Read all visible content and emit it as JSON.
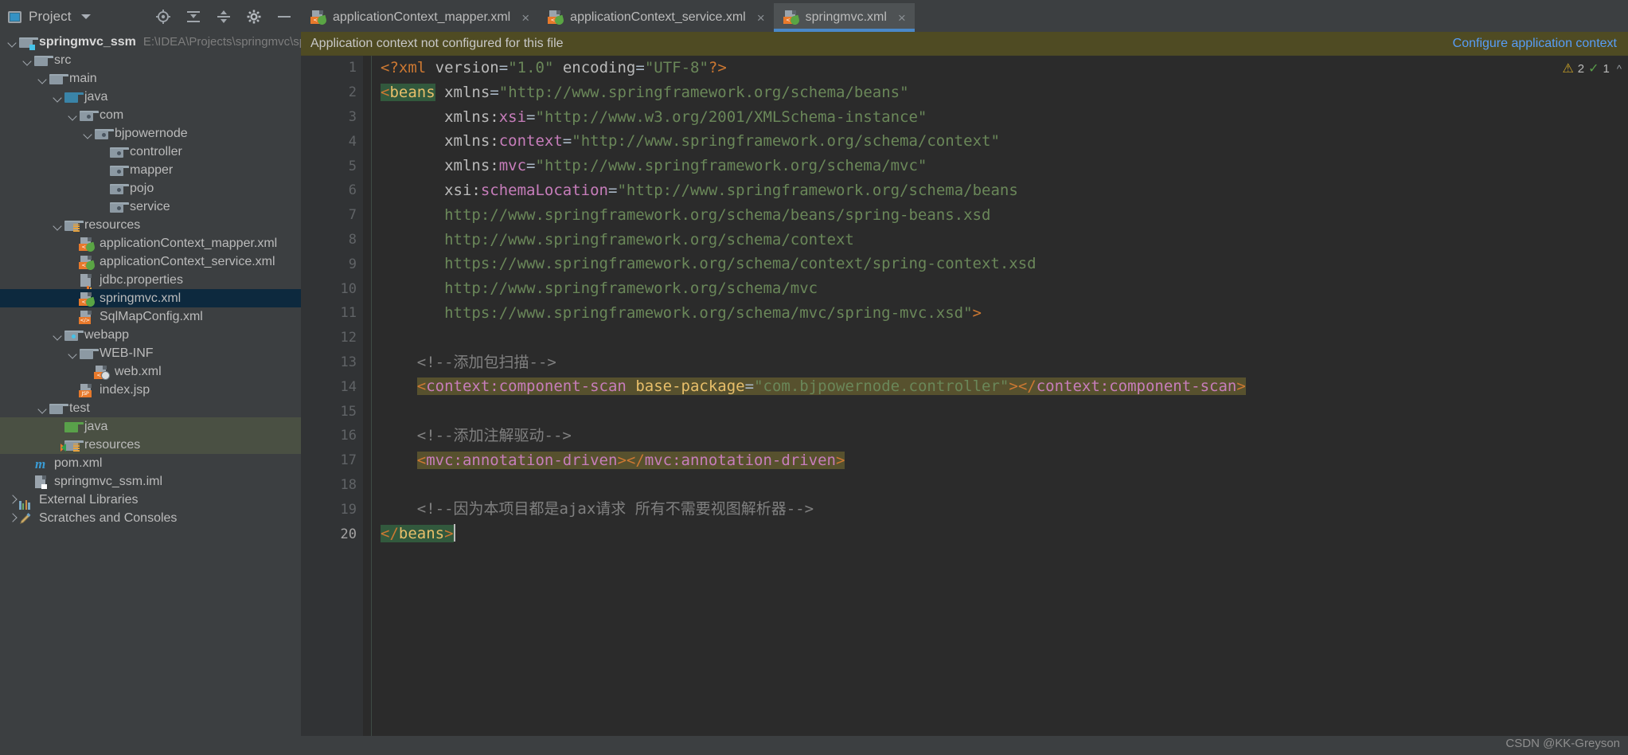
{
  "sidebar": {
    "title": "Project",
    "tools": [
      "locate-icon",
      "collapse-all-icon",
      "expand-icon",
      "settings-icon",
      "hide-icon"
    ],
    "tree": [
      {
        "label": "springmvc_ssm",
        "path": "E:\\IDEA\\Projects\\springmvc\\sprin",
        "depth": 0,
        "arrow": "open",
        "icon": "module-folder",
        "bold": true
      },
      {
        "label": "src",
        "depth": 1,
        "arrow": "open",
        "icon": "folder-grey"
      },
      {
        "label": "main",
        "depth": 2,
        "arrow": "open",
        "icon": "folder-grey"
      },
      {
        "label": "java",
        "depth": 3,
        "arrow": "open",
        "icon": "folder-blue-source"
      },
      {
        "label": "com",
        "depth": 4,
        "arrow": "open",
        "icon": "folder-package"
      },
      {
        "label": "bjpowernode",
        "depth": 5,
        "arrow": "open",
        "icon": "folder-package"
      },
      {
        "label": "controller",
        "depth": 6,
        "arrow": "none",
        "icon": "folder-package"
      },
      {
        "label": "mapper",
        "depth": 6,
        "arrow": "none",
        "icon": "folder-package"
      },
      {
        "label": "pojo",
        "depth": 6,
        "arrow": "none",
        "icon": "folder-package"
      },
      {
        "label": "service",
        "depth": 6,
        "arrow": "none",
        "icon": "folder-package"
      },
      {
        "label": "resources",
        "depth": 3,
        "arrow": "open",
        "icon": "folder-resources"
      },
      {
        "label": "applicationContext_mapper.xml",
        "depth": 4,
        "arrow": "none",
        "icon": "file-spring-xml"
      },
      {
        "label": "applicationContext_service.xml",
        "depth": 4,
        "arrow": "none",
        "icon": "file-spring-xml"
      },
      {
        "label": "jdbc.properties",
        "depth": 4,
        "arrow": "none",
        "icon": "file-properties"
      },
      {
        "label": "springmvc.xml",
        "depth": 4,
        "arrow": "none",
        "icon": "file-spring-xml",
        "selected": true
      },
      {
        "label": "SqlMapConfig.xml",
        "depth": 4,
        "arrow": "none",
        "icon": "file-xml"
      },
      {
        "label": "webapp",
        "depth": 3,
        "arrow": "open",
        "icon": "folder-webapp"
      },
      {
        "label": "WEB-INF",
        "depth": 4,
        "arrow": "open",
        "icon": "folder-grey"
      },
      {
        "label": "web.xml",
        "depth": 5,
        "arrow": "none",
        "icon": "file-web-xml"
      },
      {
        "label": "index.jsp",
        "depth": 4,
        "arrow": "none",
        "icon": "file-jsp"
      },
      {
        "label": "test",
        "depth": 2,
        "arrow": "open",
        "icon": "folder-grey"
      },
      {
        "label": "java",
        "depth": 3,
        "arrow": "none",
        "icon": "folder-test-source",
        "greenbg": true
      },
      {
        "label": "resources",
        "depth": 3,
        "arrow": "none",
        "icon": "folder-test-resources",
        "greenbg": true
      },
      {
        "label": "pom.xml",
        "depth": 1,
        "arrow": "none",
        "icon": "file-maven"
      },
      {
        "label": "springmvc_ssm.iml",
        "depth": 1,
        "arrow": "none",
        "icon": "file-iml"
      },
      {
        "label": "External Libraries",
        "depth": 0,
        "arrow": "closed",
        "icon": "libraries"
      },
      {
        "label": "Scratches and Consoles",
        "depth": 0,
        "arrow": "closed",
        "icon": "scratches"
      }
    ]
  },
  "tabs": [
    {
      "label": "applicationContext_mapper.xml",
      "icon": "spring-xml-icon",
      "active": false,
      "close": "×"
    },
    {
      "label": "applicationContext_service.xml",
      "icon": "spring-xml-icon",
      "active": false,
      "close": "×"
    },
    {
      "label": "springmvc.xml",
      "icon": "spring-xml-icon",
      "active": true,
      "close": "×"
    }
  ],
  "notification": {
    "message": "Application context not configured for this file",
    "action": "Configure application context"
  },
  "inspection": {
    "warning_icon": "warning-triangle-icon",
    "warning_count": "2",
    "ok_icon": "check-icon",
    "ok_count": "1",
    "chevron": "⌃"
  },
  "editor": {
    "line_numbers": [
      "1",
      "2",
      "3",
      "4",
      "5",
      "6",
      "7",
      "8",
      "9",
      "10",
      "11",
      "12",
      "13",
      "14",
      "15",
      "16",
      "17",
      "18",
      "19",
      "20"
    ],
    "current_line": 20,
    "gutter_spring_icon_line": 14,
    "lines": [
      {
        "n": 1,
        "text": "<?xml version=\"1.0\" encoding=\"UTF-8\"?>"
      },
      {
        "n": 2,
        "text": "<beans xmlns=\"http://www.springframework.org/schema/beans\""
      },
      {
        "n": 3,
        "text": "       xmlns:xsi=\"http://www.w3.org/2001/XMLSchema-instance\""
      },
      {
        "n": 4,
        "text": "       xmlns:context=\"http://www.springframework.org/schema/context\""
      },
      {
        "n": 5,
        "text": "       xmlns:mvc=\"http://www.springframework.org/schema/mvc\""
      },
      {
        "n": 6,
        "text": "       xsi:schemaLocation=\"http://www.springframework.org/schema/beans"
      },
      {
        "n": 7,
        "text": "       http://www.springframework.org/schema/beans/spring-beans.xsd"
      },
      {
        "n": 8,
        "text": "       http://www.springframework.org/schema/context"
      },
      {
        "n": 9,
        "text": "       https://www.springframework.org/schema/context/spring-context.xsd"
      },
      {
        "n": 10,
        "text": "       http://www.springframework.org/schema/mvc"
      },
      {
        "n": 11,
        "text": "       https://www.springframework.org/schema/mvc/spring-mvc.xsd\">"
      },
      {
        "n": 12,
        "text": ""
      },
      {
        "n": 13,
        "text": "    <!--添加包扫描-->"
      },
      {
        "n": 14,
        "text": "    <context:component-scan base-package=\"com.bjpowernode.controller\"></context:component-scan>"
      },
      {
        "n": 15,
        "text": ""
      },
      {
        "n": 16,
        "text": "    <!--添加注解驱动-->"
      },
      {
        "n": 17,
        "text": "    <mvc:annotation-driven></mvc:annotation-driven>"
      },
      {
        "n": 18,
        "text": ""
      },
      {
        "n": 19,
        "text": "    <!--因为本项目都是ajax请求 所有不需要视图解析器-->"
      },
      {
        "n": 20,
        "text": "</beans>"
      }
    ],
    "tokens": {
      "decl_open": "<?xml",
      "decl_version_attr": "version",
      "decl_version_val": "\"1.0\"",
      "decl_encoding_attr": "encoding",
      "decl_encoding_val": "\"UTF-8\"",
      "decl_close": "?>",
      "beans_open": "<beans",
      "beans_close": "</beans>",
      "xmlns": "xmlns",
      "ns_xsi": "xsi",
      "ns_context": "context",
      "ns_mvc": "mvc",
      "attr_schemaLocation": "schemaLocation",
      "comment_13": "<!--添加包扫描-->",
      "comment_16": "<!--添加注解驱动-->",
      "comment_19": "<!--因为本项目都是ajax请求 所有不需要视图解析器-->",
      "ctx_scan_open": "<context:component-scan",
      "base_package_attr": "base-package",
      "base_package_val": "\"com.bjpowernode.controller\"",
      "ctx_scan_gt": ">",
      "ctx_scan_close": "</context:component-scan>",
      "mvc_ann_open": "<mvc:annotation-driven>",
      "mvc_ann_close": "</mvc:annotation-driven>",
      "url_beans": "\"http://www.springframework.org/schema/beans\"",
      "url_xsi": "\"http://www.w3.org/2001/XMLSchema-instance\"",
      "url_context": "\"http://www.springframework.org/schema/context\"",
      "url_mvc": "\"http://www.springframework.org/schema/mvc\"",
      "schema_l1": "\"http://www.springframework.org/schema/beans",
      "schema_l2": "http://www.springframework.org/schema/beans/spring-beans.xsd",
      "schema_l3": "http://www.springframework.org/schema/context",
      "schema_l4": "https://www.springframework.org/schema/context/spring-context.xsd",
      "schema_l5": "http://www.springframework.org/schema/mvc",
      "schema_l6": "https://www.springframework.org/schema/mvc/spring-mvc.xsd\""
    }
  },
  "watermark": "CSDN @KK-Greyson",
  "colors": {
    "editor_bg": "#2b2b2b",
    "panel_bg": "#3c3f41",
    "gutter_bg": "#313335",
    "selection_blue": "#0d293e",
    "notify_bg": "#4f4b23",
    "link_blue": "#589df6",
    "tab_active": "#4e5254",
    "tab_underline": "#4a88c7",
    "string_green": "#6a8759",
    "tag_orange": "#cc7832",
    "tagname_yellow": "#e8bf6a",
    "ns_purple": "#c77dbb",
    "comment_grey": "#808080",
    "highlight_olive": "#57512e",
    "highlight_teal": "#32593d",
    "test_folder_bg": "#4a5043"
  }
}
